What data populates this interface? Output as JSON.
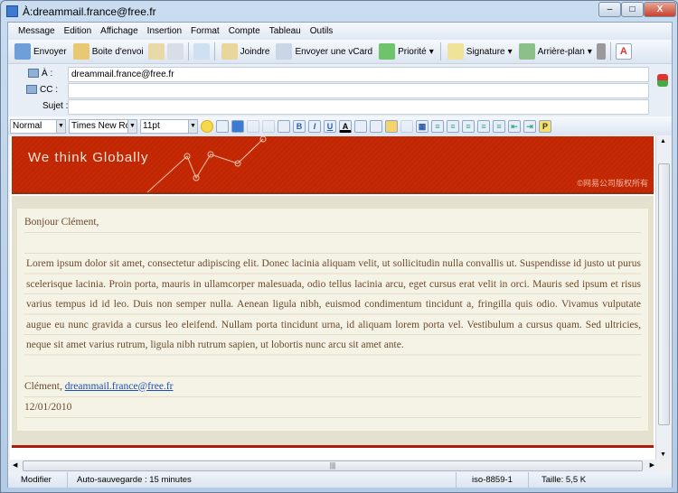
{
  "window": {
    "title": "À:dreammail.france@free.fr"
  },
  "menu": [
    "Message",
    "Edition",
    "Affichage",
    "Insertion",
    "Format",
    "Compte",
    "Tableau",
    "Outils"
  ],
  "toolbar": {
    "send": "Envoyer",
    "outbox": "Boite d'envoi",
    "attach": "Joindre",
    "vcard": "Envoyer une vCard",
    "priority": "Priorité",
    "signature": "Signature",
    "background": "Arrière-plan"
  },
  "fields": {
    "to_label": "À :",
    "to_value": "dreammail.france@free.fr",
    "cc_label": "CC :",
    "cc_value": "",
    "subject_label": "Sujet :",
    "subject_value": ""
  },
  "format": {
    "style": "Normal",
    "font": "Times New Roi",
    "size": "11pt"
  },
  "email": {
    "banner_title": "We think Globally",
    "copyright": "©网易公司版权所有",
    "greeting": "Bonjour Clément,",
    "body": "Lorem ipsum dolor sit amet, consectetur adipiscing elit. Donec lacinia aliquam velit, ut sollicitudin nulla convallis ut. Suspendisse id justo ut purus scelerisque lacinia. Proin porta, mauris in ullamcorper malesuada, odio tellus lacinia arcu, eget cursus erat velit in orci. Mauris sed ipsum et risus varius tempus id id leo. Duis non semper nulla. Aenean ligula nibh, euismod condimentum tincidunt a, fringilla quis odio. Vivamus vulputate augue eu nunc gravida a cursus leo eleifend. Nullam porta tincidunt urna, id aliquam lorem porta vel. Vestibulum a cursus quam. Sed ultricies, neque sit amet varius rutrum, ligula nibh rutrum sapien, ut lobortis nunc arcu sit amet ante.",
    "sign_name": "Clément,",
    "sign_email": "dreammail.france@free.fr",
    "date": "12/01/2010"
  },
  "status": {
    "mode": "Modifier",
    "autosave": "Auto-sauvegarde : 15 minutes",
    "encoding": "iso-8859-1",
    "size": "Taille: 5,5 K"
  }
}
